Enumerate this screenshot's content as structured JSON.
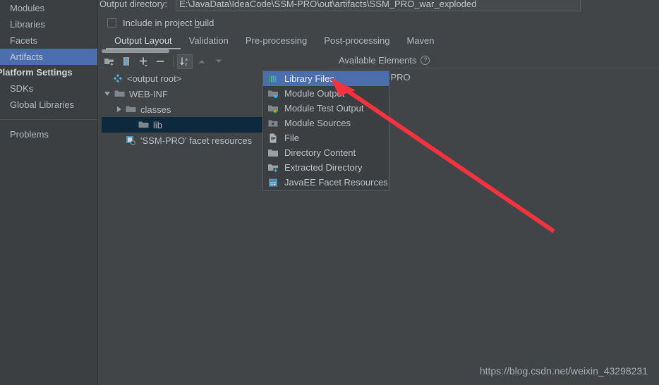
{
  "sidebar": {
    "items": [
      {
        "label": "Modules",
        "selected": false
      },
      {
        "label": "Libraries",
        "selected": false
      },
      {
        "label": "Facets",
        "selected": false
      },
      {
        "label": "Artifacts",
        "selected": true
      }
    ],
    "platform_header": "Platform Settings",
    "platform_items": [
      {
        "label": "SDKs"
      },
      {
        "label": "Global Libraries"
      }
    ],
    "problems_label": "Problems"
  },
  "output": {
    "directory_label": "Output directory:",
    "directory_value": "E:\\JavaData\\IdeaCode\\SSM-PRO\\out\\artifacts\\SSM_PRO_war_exploded",
    "include_label_pre": "Include in project ",
    "include_label_mnemonic": "b",
    "include_label_post": "uild",
    "include_checked": false
  },
  "tabs": [
    {
      "label": "Output Layout",
      "active": true
    },
    {
      "label": "Validation",
      "active": false
    },
    {
      "label": "Pre-processing",
      "active": false
    },
    {
      "label": "Post-processing",
      "active": false
    },
    {
      "label": "Maven",
      "active": false
    }
  ],
  "toolbar": {
    "buttons": [
      {
        "name": "add-directory-icon",
        "pressed": false
      },
      {
        "name": "add-archive-icon",
        "pressed": false
      },
      {
        "name": "add-icon",
        "pressed": false
      },
      {
        "name": "remove-icon",
        "pressed": false
      },
      {
        "name": "sort-alphabetically-icon",
        "pressed": true
      },
      {
        "name": "move-up-icon",
        "pressed": false
      },
      {
        "name": "move-down-icon",
        "pressed": false
      }
    ]
  },
  "available": {
    "title": "Available Elements",
    "help_glyph": "?",
    "tree": [
      {
        "label": "SSM-PRO",
        "icon": "module-icon",
        "expandable": true
      }
    ]
  },
  "tree": {
    "rows": [
      {
        "label": "<output root>",
        "icon": "artifact-icon",
        "indent": 0,
        "toggle": "none",
        "selected": false
      },
      {
        "label": "WEB-INF",
        "icon": "folder-icon",
        "indent": 1,
        "toggle": "down",
        "selected": false
      },
      {
        "label": "classes",
        "icon": "folder-icon",
        "indent": 2,
        "toggle": "right",
        "selected": false
      },
      {
        "label": "lib",
        "icon": "folder-icon",
        "indent": 3,
        "toggle": "none",
        "selected": true
      },
      {
        "label": "'SSM-PRO' facet resources",
        "icon": "javaee-facet-icon",
        "indent": 2,
        "toggle": "none",
        "selected": false
      }
    ]
  },
  "popup": {
    "items": [
      {
        "label": "Library Files",
        "icon": "library-files-icon",
        "selected": true
      },
      {
        "label": "Module Output",
        "icon": "module-output-icon",
        "selected": false
      },
      {
        "label": "Module Test Output",
        "icon": "module-test-output-icon",
        "selected": false
      },
      {
        "label": "Module Sources",
        "icon": "module-sources-icon",
        "selected": false
      },
      {
        "label": "File",
        "icon": "file-icon",
        "selected": false
      },
      {
        "label": "Directory Content",
        "icon": "directory-content-icon",
        "selected": false
      },
      {
        "label": "Extracted Directory",
        "icon": "extracted-directory-icon",
        "selected": false
      },
      {
        "label": "JavaEE Facet Resources",
        "icon": "javaee-facet-resources-icon",
        "selected": false
      }
    ]
  },
  "annotation": {
    "arrow_color": "#f5333f"
  },
  "watermark": "https://blog.csdn.net/weixin_43298231"
}
